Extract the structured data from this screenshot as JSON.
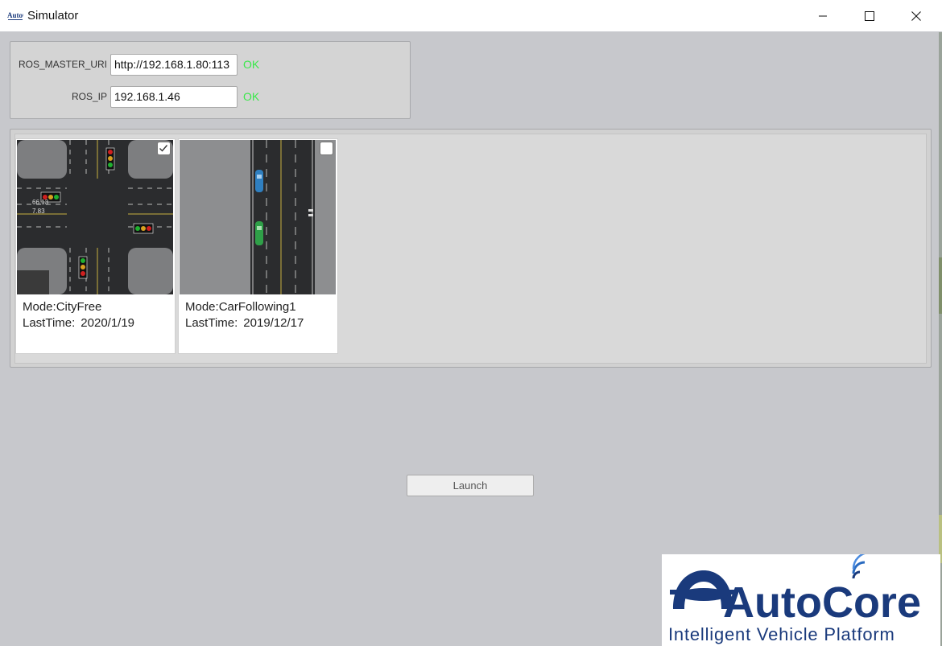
{
  "window": {
    "title": "Simulator",
    "app_icon_text": "AutoCore"
  },
  "ros": {
    "master_uri_label": "ROS_MASTER_URI",
    "master_uri_value": "http://192.168.1.80:113",
    "master_uri_status": "OK",
    "ip_label": "ROS_IP",
    "ip_value": "192.168.1.46",
    "ip_status": "OK"
  },
  "scenes": [
    {
      "mode_label": "Mode:",
      "mode": "CityFree",
      "time_label": "LastTime:",
      "last_time": "2020/1/19",
      "checked": true,
      "thumb_text_1": "66.13",
      "thumb_text_2": "7.83"
    },
    {
      "mode_label": "Mode:",
      "mode": "CarFollowing1",
      "time_label": "LastTime:",
      "last_time": "2019/12/17",
      "checked": false
    }
  ],
  "launch": {
    "label": "Launch"
  },
  "logo": {
    "wordmark": "AutoCore",
    "tagline": "Intelligent Vehicle Platform"
  },
  "colors": {
    "ok_green": "#3ae84a",
    "logo_blue": "#1a3a7c",
    "background": "#c7c8cc"
  }
}
